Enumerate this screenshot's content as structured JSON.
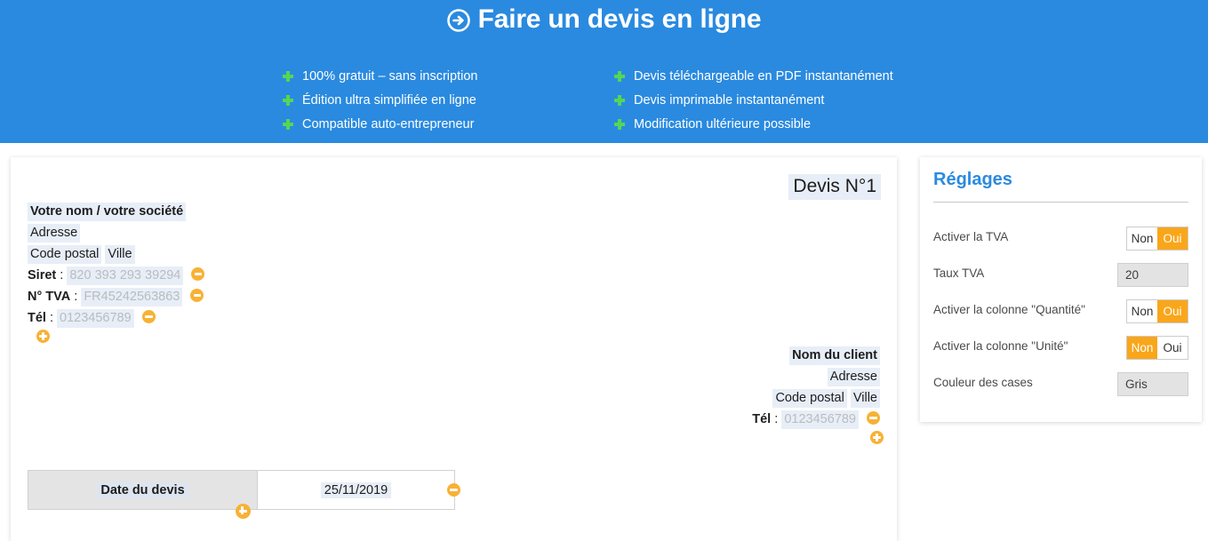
{
  "banner": {
    "title": "Faire un devis en ligne",
    "arrow_icon": "arrow-right-circle-icon",
    "features_left": [
      "100% gratuit – sans inscription",
      "Édition ultra simplifiée en ligne",
      "Compatible auto-entrepreneur"
    ],
    "features_right": [
      "Devis téléchargeable en PDF instantanément",
      "Devis imprimable instantanément",
      "Modification ultérieure possible"
    ],
    "background_color": "#2a8ae0",
    "bullet_color": "#55d655"
  },
  "document": {
    "devis_title": "Devis N°1",
    "sender": {
      "name": "Votre nom / votre société",
      "address": "Adresse",
      "postal_code": "Code postal",
      "city": "Ville",
      "siret_label": "Siret",
      "siret_value": "820 393 293 39294",
      "tva_label": "N° TVA",
      "tva_value": "FR45242563863",
      "tel_label": "Tél",
      "tel_value": "0123456789",
      "colon": ":"
    },
    "client": {
      "name": "Nom du client",
      "address": "Adresse",
      "postal_code": "Code postal",
      "city": "Ville",
      "tel_label": "Tél",
      "tel_value": "0123456789",
      "colon": ":"
    },
    "date_row": {
      "label": "Date du devis",
      "value": "25/11/2019"
    },
    "field_highlight_color": "#e8eef7",
    "placeholder_color": "#b9bcc0",
    "icon_color": "#f8b134"
  },
  "settings": {
    "title": "Réglages",
    "title_color": "#2a8ae0",
    "accent_color": "#f9a61a",
    "rows": [
      {
        "label": "Activer la TVA",
        "type": "toggle",
        "options": [
          "Non",
          "Oui"
        ],
        "selected": "Oui"
      },
      {
        "label": "Taux TVA",
        "type": "input",
        "value": "20"
      },
      {
        "label": "Activer la colonne \"Quantité\"",
        "type": "toggle",
        "options": [
          "Non",
          "Oui"
        ],
        "selected": "Oui"
      },
      {
        "label": "Activer la colonne \"Unité\"",
        "type": "toggle",
        "options": [
          "Non",
          "Oui"
        ],
        "selected": "Non"
      },
      {
        "label": "Couleur des cases",
        "type": "input",
        "value": "Gris"
      }
    ]
  }
}
